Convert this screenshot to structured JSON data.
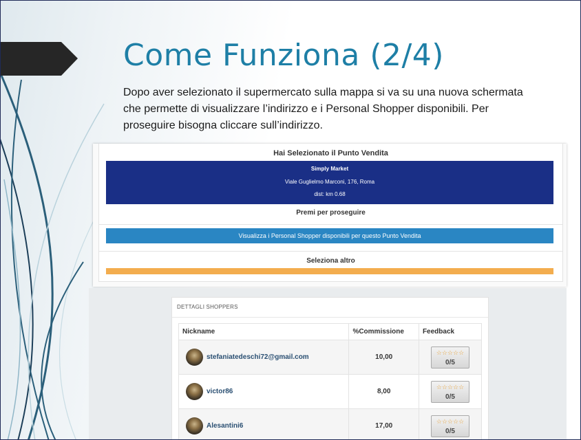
{
  "slide": {
    "title": "Come Funziona (2/4)",
    "description": "Dopo aver selezionato il supermercato sulla mappa si va su una nuova schermata che permette di visualizzare l’indirizzo e i Personal Shopper disponibili. Per proseguire bisogna  cliccare sull’indirizzo."
  },
  "store_panel": {
    "heading": "Hai Selezionato il Punto Vendita",
    "store_name": "Simply Market",
    "address": "Viale Guglielmo Marconi, 176, Roma",
    "distance": "dist: km 0.68",
    "continue_label": "Premi per proseguire",
    "show_shoppers_button": "Visualizza i Personal Shopper disponibili per questo Punto Vendita",
    "select_other_label": "Seleziona altro"
  },
  "shoppers_panel": {
    "heading": "DETTAGLI SHOPPERS",
    "columns": [
      "Nickname",
      "%Commissione",
      "Feedback"
    ],
    "rows": [
      {
        "nickname": "stefaniatedeschi72@gmail.com",
        "commission": "10,00",
        "stars": "☆☆☆☆☆",
        "score": "0/5"
      },
      {
        "nickname": "victor86",
        "commission": "8,00",
        "stars": "☆☆☆☆☆",
        "score": "0/5"
      },
      {
        "nickname": "Alesantini6",
        "commission": "17,00",
        "stars": "☆☆☆☆☆",
        "score": "0/5"
      }
    ]
  },
  "colors": {
    "title": "#1e7fa6",
    "store_box": "#1a2f86",
    "primary_button": "#2a86c3",
    "secondary_button": "#f3ad4e",
    "stars": "#e8a33a"
  }
}
